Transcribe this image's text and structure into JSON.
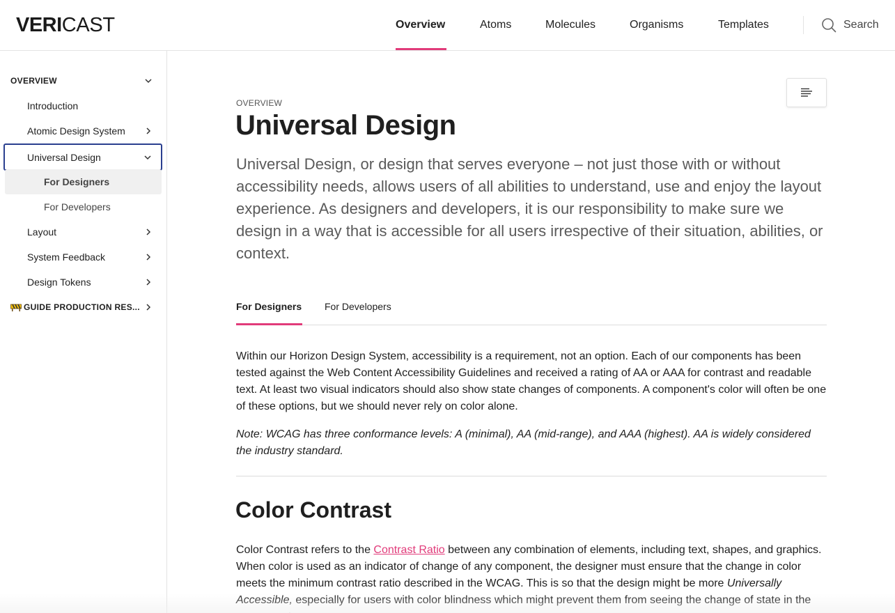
{
  "brand": {
    "logo_bold": "VERI",
    "logo_light": "CAST"
  },
  "nav": {
    "items": [
      {
        "label": "Overview"
      },
      {
        "label": "Atoms"
      },
      {
        "label": "Molecules"
      },
      {
        "label": "Organisms"
      },
      {
        "label": "Templates"
      }
    ],
    "active_index": 0,
    "search_label": "Search",
    "search_icon": "search-icon"
  },
  "sidebar": {
    "section_title": "OVERVIEW",
    "items": [
      {
        "label": "Introduction"
      },
      {
        "label": "Atomic Design System"
      },
      {
        "label": "Universal Design"
      },
      {
        "label": "For Designers"
      },
      {
        "label": "For Developers"
      },
      {
        "label": "Layout"
      },
      {
        "label": "System Feedback"
      },
      {
        "label": "Design Tokens"
      }
    ],
    "guide_title": "GUIDE PRODUCTION RES...",
    "guide_icon": "construction-sign-icon"
  },
  "content": {
    "eyebrow": "OVERVIEW",
    "title": "Universal Design",
    "lead": "Universal Design, or design that serves everyone – not just those with or without accessibility needs, allows users of all abilities to understand, use and enjoy the layout experience. As designers and developers, it is our responsibility to make sure we design in a way that is accessible for all users irrespective of their situation, abilities, or context.",
    "tabs": [
      {
        "label": "For Designers"
      },
      {
        "label": "For Developers"
      }
    ],
    "active_tab": 0,
    "para1": "Within our Horizon Design System, accessibility is a requirement, not an option. Each of our components has been tested against the Web Content Accessibility Guidelines and received a rating of AA or AAA for contrast and readable text. At least two visual indicators should also show state changes of components. A component's color will often be one of these options, but we should never rely on color alone.",
    "note": "Note: WCAG has three conformance levels: A (minimal), AA (mid-range), and AAA (highest). AA is widely considered the industry standard.",
    "section_title": "Color Contrast",
    "section_para_before": "Color Contrast refers to the ",
    "section_link": "Contrast Ratio",
    "section_para_after": " between any combination of elements, including text, shapes, and graphics. When color is used as an indicator of change of any component, the designer must ensure that the change in color meets the minimum contrast ratio described in the WCAG. This is so that the design might be more ",
    "section_para_em": "Universally Accessible,",
    "section_para_end": " especially for users with color blindness which might prevent them from seeing the change of state in the component."
  },
  "colors": {
    "accent": "#e13b7a",
    "focus_ring": "#2a3f8f"
  }
}
